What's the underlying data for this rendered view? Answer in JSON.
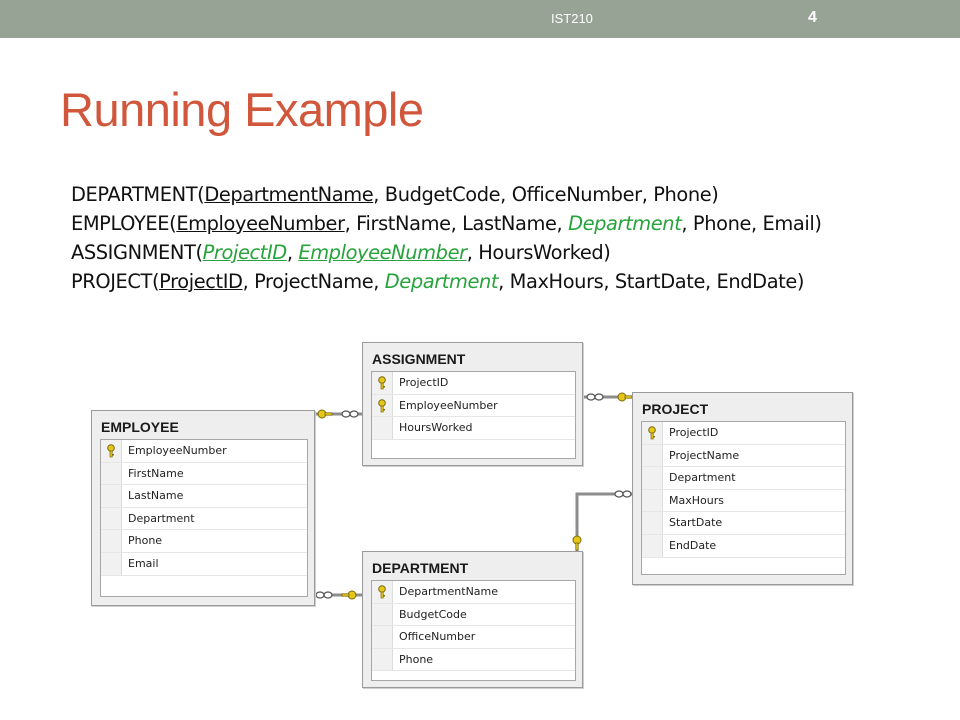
{
  "header": {
    "course": "IST210",
    "slide_number": "4"
  },
  "title": "Running Example",
  "schema": {
    "department": {
      "name": "DEPARTMENT(",
      "pk": "DepartmentName",
      "rest": ", BudgetCode, OfficeNumber, Phone)"
    },
    "employee": {
      "name": "EMPLOYEE(",
      "pk": "EmployeeNumber",
      "mid": ", FirstName, LastName, ",
      "fk": "Department",
      "rest": ", Phone, Email)"
    },
    "assignment": {
      "name": "ASSIGNMENT(",
      "pk1": "ProjectID",
      "sep": ", ",
      "pk2": "EmployeeNumber",
      "rest": ", HoursWorked)"
    },
    "project": {
      "name": "PROJECT(",
      "pk": "ProjectID",
      "mid": ", ProjectName, ",
      "fk": "Department",
      "rest": ", MaxHours, StartDate, EndDate)"
    }
  },
  "tables": {
    "assignment": {
      "title": "ASSIGNMENT",
      "columns": [
        "ProjectID",
        "EmployeeNumber",
        "HoursWorked"
      ],
      "keys": [
        true,
        true,
        false
      ]
    },
    "employee": {
      "title": "EMPLOYEE",
      "columns": [
        "EmployeeNumber",
        "FirstName",
        "LastName",
        "Department",
        "Phone",
        "Email"
      ],
      "keys": [
        true,
        false,
        false,
        false,
        false,
        false
      ]
    },
    "project": {
      "title": "PROJECT",
      "columns": [
        "ProjectID",
        "ProjectName",
        "Department",
        "MaxHours",
        "StartDate",
        "EndDate"
      ],
      "keys": [
        true,
        false,
        false,
        false,
        false,
        false
      ]
    },
    "department": {
      "title": "DEPARTMENT",
      "columns": [
        "DepartmentName",
        "BudgetCode",
        "OfficeNumber",
        "Phone"
      ],
      "keys": [
        true,
        false,
        false,
        false
      ]
    }
  },
  "colors": {
    "header_bar": "#97a495",
    "title": "#d0573c",
    "foreign_key": "#27a33c",
    "key_icon": "#e6c619"
  }
}
